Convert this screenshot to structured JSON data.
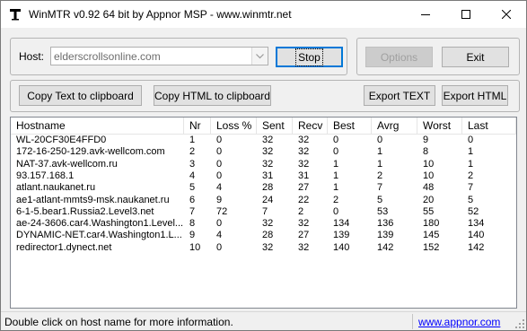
{
  "window": {
    "title": "WinMTR v0.92 64 bit by Appnor MSP - www.winmtr.net"
  },
  "host": {
    "label": "Host:",
    "value": "elderscrollsonline.com"
  },
  "buttons": {
    "stop": "Stop",
    "options": "Options",
    "exit": "Exit",
    "copy_text": "Copy Text to clipboard",
    "copy_html": "Copy HTML to clipboard",
    "export_text": "Export TEXT",
    "export_html": "Export HTML"
  },
  "table": {
    "columns": [
      "Hostname",
      "Nr",
      "Loss %",
      "Sent",
      "Recv",
      "Best",
      "Avrg",
      "Worst",
      "Last"
    ],
    "rows": [
      [
        "WL-20CF30E4FFD0",
        "1",
        "0",
        "32",
        "32",
        "0",
        "0",
        "9",
        "0"
      ],
      [
        "172-16-250-129.avk-wellcom.com",
        "2",
        "0",
        "32",
        "32",
        "0",
        "1",
        "8",
        "1"
      ],
      [
        "NAT-37.avk-wellcom.ru",
        "3",
        "0",
        "32",
        "32",
        "1",
        "1",
        "10",
        "1"
      ],
      [
        "93.157.168.1",
        "4",
        "0",
        "31",
        "31",
        "1",
        "2",
        "10",
        "2"
      ],
      [
        "atlant.naukanet.ru",
        "5",
        "4",
        "28",
        "27",
        "1",
        "7",
        "48",
        "7"
      ],
      [
        "ae1-atlant-mmts9-msk.naukanet.ru",
        "6",
        "9",
        "24",
        "22",
        "2",
        "5",
        "20",
        "5"
      ],
      [
        "6-1-5.bear1.Russia2.Level3.net",
        "7",
        "72",
        "7",
        "2",
        "0",
        "53",
        "55",
        "52"
      ],
      [
        "ae-24-3606.car4.Washington1.Level...",
        "8",
        "0",
        "32",
        "32",
        "134",
        "136",
        "180",
        "134"
      ],
      [
        "DYNAMIC-NET.car4.Washington1.L...",
        "9",
        "4",
        "28",
        "27",
        "139",
        "139",
        "145",
        "140"
      ],
      [
        "redirector1.dynect.net",
        "10",
        "0",
        "32",
        "32",
        "140",
        "142",
        "152",
        "142"
      ]
    ]
  },
  "status": {
    "text": "Double click on host name for more information.",
    "link": "www.appnor.com"
  }
}
